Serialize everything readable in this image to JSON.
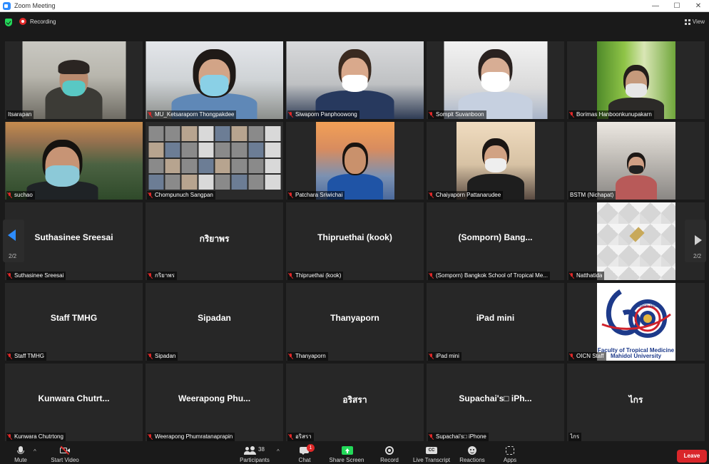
{
  "window": {
    "title": "Zoom Meeting",
    "controls": [
      "—",
      "☐",
      "✕"
    ]
  },
  "topbar": {
    "recording_label": "Recording",
    "view_label": "View"
  },
  "pagination": {
    "left_page": "2/2",
    "right_page": "2/2"
  },
  "tiles": [
    {
      "label": "Itsarapan",
      "center": ""
    },
    {
      "label": "MU_Ketsaraporn Thongpakdee",
      "center": ""
    },
    {
      "label": "Siwaporn Panphoowong",
      "center": ""
    },
    {
      "label": "Sompit Suvanboon",
      "center": ""
    },
    {
      "label": "Borimas Hanboonkunupakarn",
      "center": ""
    },
    {
      "label": "suchao",
      "center": ""
    },
    {
      "label": "Chompunuch Sangpan",
      "center": ""
    },
    {
      "label": "Patchara Sriwichai",
      "center": ""
    },
    {
      "label": "Chaiyaporn Pattanarudee",
      "center": ""
    },
    {
      "label": "BSTM (Nichapat)",
      "center": ""
    },
    {
      "label": "Suthasinee Sreesai",
      "center": "Suthasinee Sreesai"
    },
    {
      "label": "กริยาพร",
      "center": "กริยาพร"
    },
    {
      "label": "Thipruethai (kook)",
      "center": "Thipruethai (kook)"
    },
    {
      "label": "(Somporn) Bangkok School of Tropical Me...",
      "center": "(Somporn)  Bang..."
    },
    {
      "label": "Natthatida",
      "center": ""
    },
    {
      "label": "Staff TMHG",
      "center": "Staff TMHG"
    },
    {
      "label": "Sipadan",
      "center": "Sipadan"
    },
    {
      "label": "Thanyaporn",
      "center": "Thanyaporn"
    },
    {
      "label": "iPad mini",
      "center": "iPad mini"
    },
    {
      "label": "OICN Staff",
      "center": ""
    },
    {
      "label": "Kunwara Chutrtong",
      "center": "Kunwara  Chutrt..."
    },
    {
      "label": "Weerapong Phumratanaprapin",
      "center": "Weerapong  Phu..."
    },
    {
      "label": "อริสรา",
      "center": "อริสรา"
    },
    {
      "label": "Supachai's□ iPhone",
      "center": "Supachai's□ iPh..."
    },
    {
      "label": "ไกร",
      "center": "ไกร"
    }
  ],
  "logo": {
    "line1": "Faculty of Tropical Medicine",
    "line2": "Mahidol University",
    "since": "SINCE 1960"
  },
  "toolbar": {
    "mute": "Mute",
    "start_video": "Start Video",
    "participants": "Participants",
    "participants_count": "38",
    "chat": "Chat",
    "chat_badge": "1",
    "share_screen": "Share Screen",
    "record": "Record",
    "live_transcript": "Live Transcript",
    "live_transcript_icon": "CC",
    "reactions": "Reactions",
    "apps": "Apps",
    "leave": "Leave"
  },
  "colors": {
    "accent": "#2d8cff",
    "leave": "#d9262a",
    "recording": "#e02828",
    "security": "#23d959",
    "share": "#23d959"
  }
}
